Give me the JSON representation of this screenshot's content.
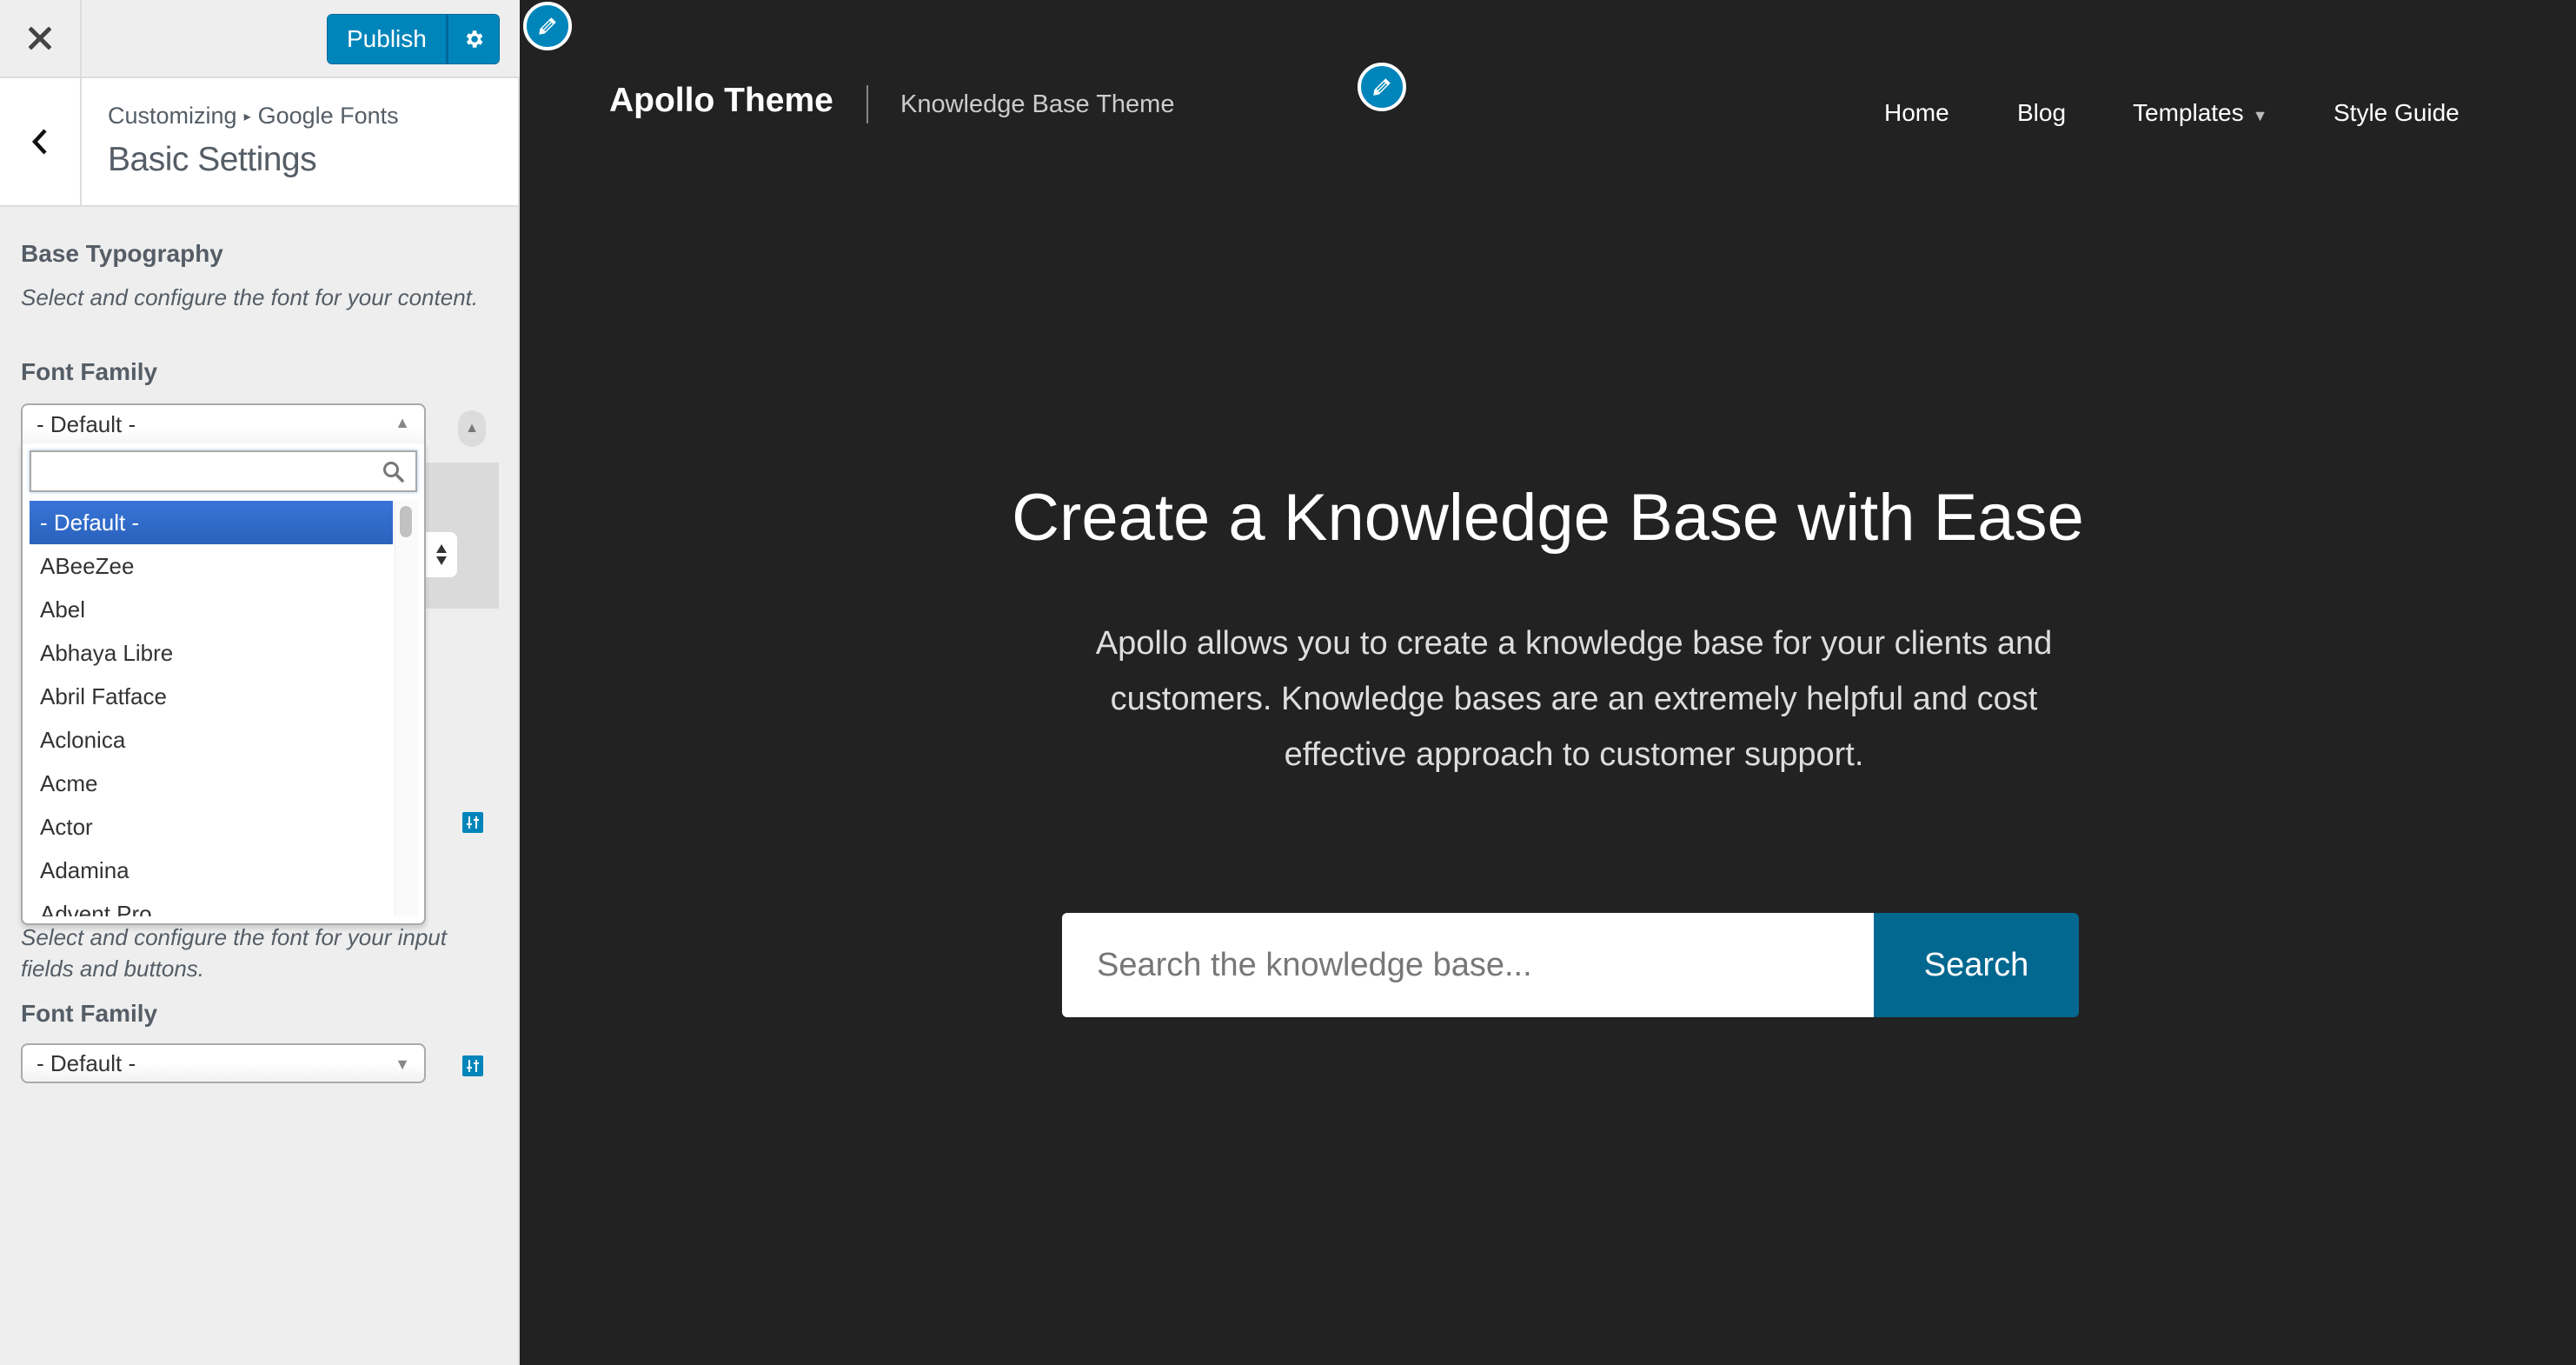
{
  "customizer": {
    "publish_label": "Publish",
    "breadcrumb": {
      "root": "Customizing",
      "separator": "▸",
      "section": "Google Fonts"
    },
    "section_title": "Basic Settings",
    "controls": [
      {
        "title": "Base Typography",
        "description": "Select and configure the font for your content.",
        "field_label": "Font Family",
        "selected": "- Default -"
      },
      {
        "description": "Select and configure the font for your input fields and buttons.",
        "field_label": "Font Family",
        "selected": "- Default -"
      }
    ],
    "dropdown": {
      "search_value": "",
      "options": [
        "- Default -",
        "ABeeZee",
        "Abel",
        "Abhaya Libre",
        "Abril Fatface",
        "Aclonica",
        "Acme",
        "Actor",
        "Adamina",
        "Advent Pro"
      ],
      "selected_index": 0
    }
  },
  "preview": {
    "site_title": "Apollo Theme",
    "tagline": "Knowledge Base Theme",
    "nav": [
      "Home",
      "Blog",
      "Templates",
      "Style Guide"
    ],
    "hero": {
      "title": "Create a Knowledge Base with Ease",
      "text": "Apollo allows you to create a knowledge base for your clients and customers. Knowledge bases are an extremely helpful and cost effective approach to customer support."
    },
    "search": {
      "placeholder": "Search the knowledge base...",
      "value": "",
      "button_label": "Search"
    }
  },
  "colors": {
    "accent": "#0085ba",
    "search_button": "#03688f",
    "preview_bg": "#222222",
    "sidebar_bg": "#eeeeee",
    "selected_option": "#3875d7"
  }
}
